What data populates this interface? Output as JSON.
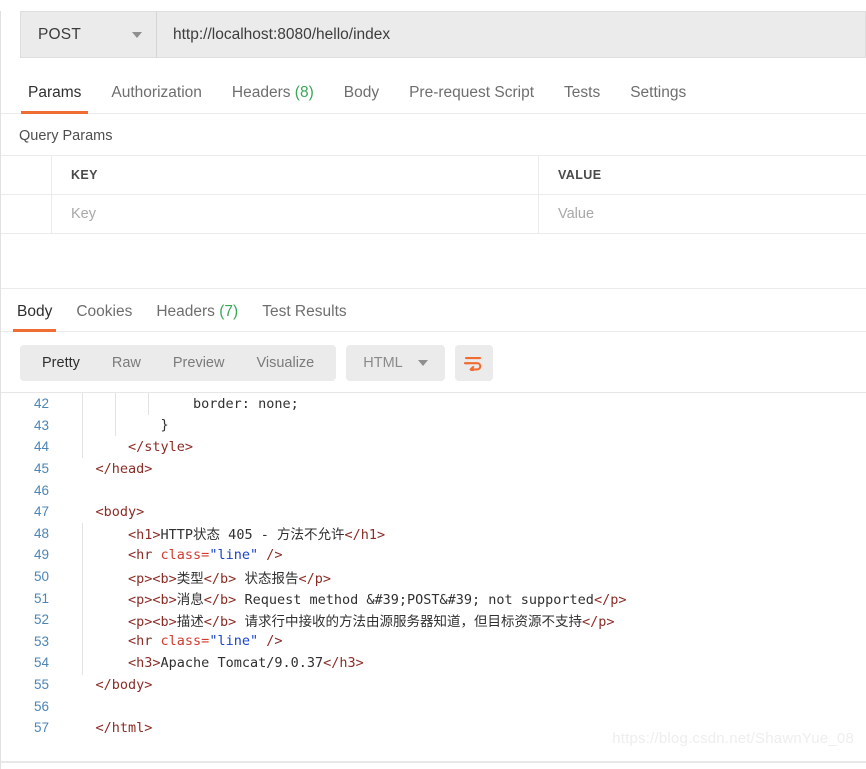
{
  "request": {
    "method": "POST",
    "method_icon": "chevron-down-icon",
    "url": "http://localhost:8080/hello/index",
    "tabs": [
      {
        "label": "Params",
        "count": "",
        "active": true
      },
      {
        "label": "Authorization",
        "count": "",
        "active": false
      },
      {
        "label": "Headers",
        "count": "(8)",
        "active": false
      },
      {
        "label": "Body",
        "count": "",
        "active": false
      },
      {
        "label": "Pre-request Script",
        "count": "",
        "active": false
      },
      {
        "label": "Tests",
        "count": "",
        "active": false
      },
      {
        "label": "Settings",
        "count": "",
        "active": false
      }
    ]
  },
  "query_params": {
    "title": "Query Params",
    "columns": [
      "KEY",
      "VALUE"
    ],
    "rows": [
      {
        "key_placeholder": "Key",
        "value_placeholder": "Value"
      }
    ]
  },
  "response": {
    "tabs": [
      {
        "label": "Body",
        "count": "",
        "active": true
      },
      {
        "label": "Cookies",
        "count": "",
        "active": false
      },
      {
        "label": "Headers",
        "count": "(7)",
        "active": false
      },
      {
        "label": "Test Results",
        "count": "",
        "active": false
      }
    ],
    "view_modes": [
      {
        "label": "Pretty",
        "active": true
      },
      {
        "label": "Raw",
        "active": false
      },
      {
        "label": "Preview",
        "active": false
      },
      {
        "label": "Visualize",
        "active": false
      }
    ],
    "format": {
      "label": "HTML",
      "icon": "chevron-down-icon"
    },
    "wrap_button": {
      "icon": "word-wrap-icon",
      "color": "#ef6c33"
    },
    "code_lines": [
      {
        "number": "42",
        "segments": [
          {
            "t": "txt",
            "v": "                border: none;"
          }
        ]
      },
      {
        "number": "43",
        "segments": [
          {
            "t": "txt",
            "v": "            }"
          }
        ]
      },
      {
        "number": "44",
        "segments": [
          {
            "t": "tag",
            "v": "        </style>"
          }
        ]
      },
      {
        "number": "45",
        "segments": [
          {
            "t": "tag",
            "v": "    </head>"
          }
        ]
      },
      {
        "number": "46",
        "segments": [
          {
            "t": "txt",
            "v": ""
          }
        ]
      },
      {
        "number": "47",
        "segments": [
          {
            "t": "tag",
            "v": "    <body>"
          }
        ]
      },
      {
        "number": "48",
        "segments": [
          {
            "t": "tag",
            "v": "        <h1>"
          },
          {
            "t": "txt",
            "v": "HTTP状态 405 - 方法不允许"
          },
          {
            "t": "tag",
            "v": "</h1>"
          }
        ]
      },
      {
        "number": "49",
        "segments": [
          {
            "t": "tag",
            "v": "        <hr "
          },
          {
            "t": "attr",
            "v": "class="
          },
          {
            "t": "str",
            "v": "\"line\""
          },
          {
            "t": "tag",
            "v": " />"
          }
        ]
      },
      {
        "number": "50",
        "segments": [
          {
            "t": "tag",
            "v": "        <p><b>"
          },
          {
            "t": "txt",
            "v": "类型"
          },
          {
            "t": "tag",
            "v": "</b>"
          },
          {
            "t": "txt",
            "v": " 状态报告"
          },
          {
            "t": "tag",
            "v": "</p>"
          }
        ]
      },
      {
        "number": "51",
        "segments": [
          {
            "t": "tag",
            "v": "        <p><b>"
          },
          {
            "t": "txt",
            "v": "消息"
          },
          {
            "t": "tag",
            "v": "</b>"
          },
          {
            "t": "txt",
            "v": " Request method &#39;POST&#39; not supported"
          },
          {
            "t": "tag",
            "v": "</p>"
          }
        ]
      },
      {
        "number": "52",
        "segments": [
          {
            "t": "tag",
            "v": "        <p><b>"
          },
          {
            "t": "txt",
            "v": "描述"
          },
          {
            "t": "tag",
            "v": "</b>"
          },
          {
            "t": "txt",
            "v": " 请求行中接收的方法由源服务器知道，但目标资源不支持"
          },
          {
            "t": "tag",
            "v": "</p>"
          }
        ]
      },
      {
        "number": "53",
        "segments": [
          {
            "t": "tag",
            "v": "        <hr "
          },
          {
            "t": "attr",
            "v": "class="
          },
          {
            "t": "str",
            "v": "\"line\""
          },
          {
            "t": "tag",
            "v": " />"
          }
        ]
      },
      {
        "number": "54",
        "segments": [
          {
            "t": "tag",
            "v": "        <h3>"
          },
          {
            "t": "txt",
            "v": "Apache Tomcat/9.0.37"
          },
          {
            "t": "tag",
            "v": "</h3>"
          }
        ]
      },
      {
        "number": "55",
        "segments": [
          {
            "t": "tag",
            "v": "    </body>"
          }
        ]
      },
      {
        "number": "56",
        "segments": [
          {
            "t": "txt",
            "v": ""
          }
        ]
      },
      {
        "number": "57",
        "segments": [
          {
            "t": "tag",
            "v": "    </html>"
          }
        ]
      }
    ]
  },
  "watermark": "https://blog.csdn.net/ShawnYue_08",
  "colors": {
    "accent": "#ef6c33",
    "count_green": "#3aa757",
    "line_number": "#4d85b5",
    "tag": "#8b2c26",
    "attribute": "#d23b2f",
    "string": "#1b44c8"
  }
}
